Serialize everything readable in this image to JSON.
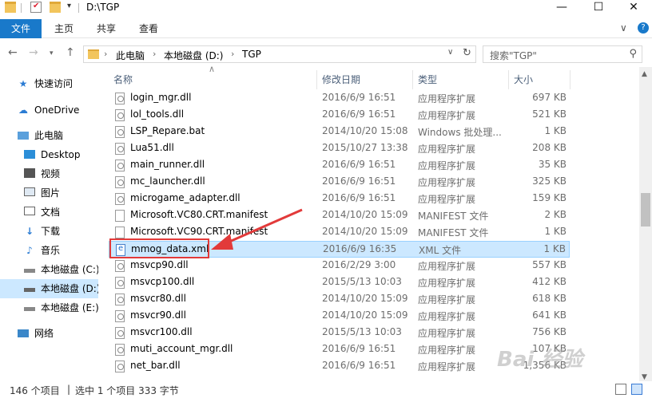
{
  "window": {
    "title": "D:\\TGP",
    "controls": {
      "minimize": "—",
      "maximize": "☐",
      "close": "✕"
    }
  },
  "ribbon": {
    "tabs": [
      "文件",
      "主页",
      "共享",
      "查看"
    ],
    "collapse": "∨",
    "help": "?"
  },
  "address": {
    "crumbs": [
      "此电脑",
      "本地磁盘 (D:)",
      "TGP"
    ],
    "search_placeholder": "搜索\"TGP\""
  },
  "sidebar": {
    "items": [
      {
        "label": "快速访问",
        "icon": "star-icon"
      },
      {
        "label": "OneDrive",
        "icon": "cloud-icon"
      },
      {
        "label": "此电脑",
        "icon": "computer-icon"
      },
      {
        "label": "Desktop",
        "icon": "desktop-icon"
      },
      {
        "label": "视频",
        "icon": "video-icon"
      },
      {
        "label": "图片",
        "icon": "picture-icon"
      },
      {
        "label": "文档",
        "icon": "document-icon"
      },
      {
        "label": "下载",
        "icon": "download-icon"
      },
      {
        "label": "音乐",
        "icon": "music-icon"
      },
      {
        "label": "本地磁盘 (C:)",
        "icon": "drive-icon"
      },
      {
        "label": "本地磁盘 (D:)",
        "icon": "drive-icon"
      },
      {
        "label": "本地磁盘 (E:)",
        "icon": "drive-icon"
      },
      {
        "label": "网络",
        "icon": "network-icon"
      }
    ]
  },
  "columns": {
    "name": "名称",
    "date": "修改日期",
    "type": "类型",
    "size": "大小"
  },
  "files": [
    {
      "name": "login_mgr.dll",
      "date": "2016/6/9 16:51",
      "type": "应用程序扩展",
      "size": "697 KB",
      "icon": "dll"
    },
    {
      "name": "lol_tools.dll",
      "date": "2016/6/9 16:51",
      "type": "应用程序扩展",
      "size": "521 KB",
      "icon": "dll"
    },
    {
      "name": "LSP_Repare.bat",
      "date": "2014/10/20 15:08",
      "type": "Windows 批处理...",
      "size": "1 KB",
      "icon": "bat"
    },
    {
      "name": "Lua51.dll",
      "date": "2015/10/27 13:38",
      "type": "应用程序扩展",
      "size": "208 KB",
      "icon": "dll"
    },
    {
      "name": "main_runner.dll",
      "date": "2016/6/9 16:51",
      "type": "应用程序扩展",
      "size": "35 KB",
      "icon": "dll"
    },
    {
      "name": "mc_launcher.dll",
      "date": "2016/6/9 16:51",
      "type": "应用程序扩展",
      "size": "325 KB",
      "icon": "dll"
    },
    {
      "name": "microgame_adapter.dll",
      "date": "2016/6/9 16:51",
      "type": "应用程序扩展",
      "size": "159 KB",
      "icon": "dll"
    },
    {
      "name": "Microsoft.VC80.CRT.manifest",
      "date": "2014/10/20 15:09",
      "type": "MANIFEST 文件",
      "size": "2 KB",
      "icon": "plain"
    },
    {
      "name": "Microsoft.VC90.CRT.manifest",
      "date": "2014/10/20 15:09",
      "type": "MANIFEST 文件",
      "size": "1 KB",
      "icon": "plain"
    },
    {
      "name": "mmog_data.xml",
      "date": "2016/6/9 16:35",
      "type": "XML 文件",
      "size": "1 KB",
      "icon": "xml",
      "selected": true
    },
    {
      "name": "msvcp90.dll",
      "date": "2016/2/29 3:00",
      "type": "应用程序扩展",
      "size": "557 KB",
      "icon": "dll"
    },
    {
      "name": "msvcp100.dll",
      "date": "2015/5/13 10:03",
      "type": "应用程序扩展",
      "size": "412 KB",
      "icon": "dll"
    },
    {
      "name": "msvcr80.dll",
      "date": "2014/10/20 15:09",
      "type": "应用程序扩展",
      "size": "618 KB",
      "icon": "dll"
    },
    {
      "name": "msvcr90.dll",
      "date": "2014/10/20 15:09",
      "type": "应用程序扩展",
      "size": "641 KB",
      "icon": "dll"
    },
    {
      "name": "msvcr100.dll",
      "date": "2015/5/13 10:03",
      "type": "应用程序扩展",
      "size": "756 KB",
      "icon": "dll"
    },
    {
      "name": "muti_account_mgr.dll",
      "date": "2016/6/9 16:51",
      "type": "应用程序扩展",
      "size": "107 KB",
      "icon": "dll"
    },
    {
      "name": "net_bar.dll",
      "date": "2016/6/9 16:51",
      "type": "应用程序扩展",
      "size": "1,356 KB",
      "icon": "dll"
    }
  ],
  "status": {
    "count": "146 个项目",
    "selection": "选中 1 个项目  333 字节"
  },
  "watermark": "Bai 经验",
  "colors": {
    "accent": "#1979ca",
    "selection": "#cce8ff",
    "annotation": "#e23a3a"
  }
}
